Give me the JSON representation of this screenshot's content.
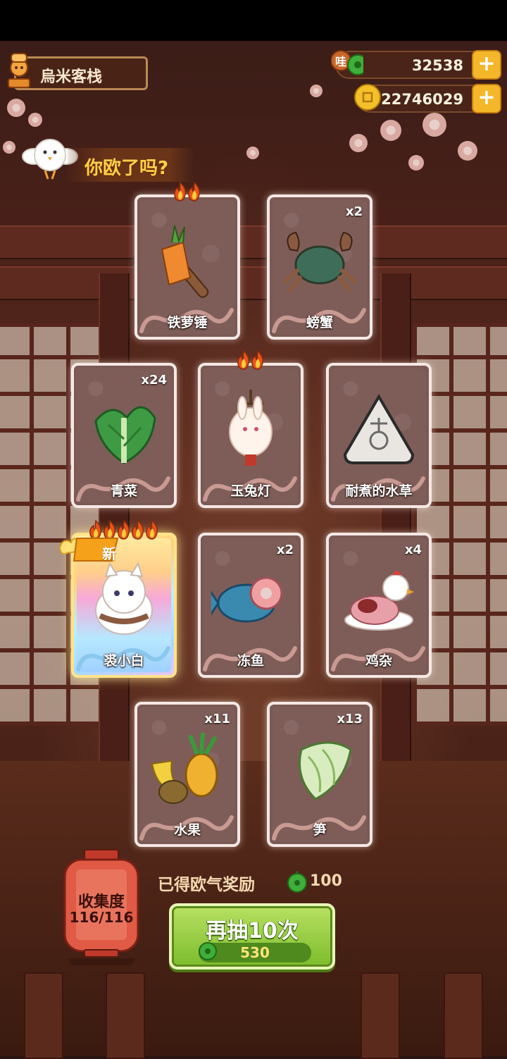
{
  "header": {
    "inn_name": "烏米客栈",
    "gems": "32538",
    "gem_badge": "哇",
    "coins": "22746029",
    "plus": "+"
  },
  "slogan": "你欧了吗?",
  "cards": [
    {
      "name": "铁萝锤",
      "count": "",
      "flames": 2,
      "art": "carrot-hammer",
      "rare": false,
      "new": false
    },
    {
      "name": "螃蟹",
      "count": "x2",
      "flames": 0,
      "art": "crab",
      "rare": false,
      "new": false
    },
    {
      "name": "青菜",
      "count": "x24",
      "flames": 0,
      "art": "bok-choy",
      "rare": false,
      "new": false
    },
    {
      "name": "玉兔灯",
      "count": "",
      "flames": 2,
      "art": "rabbit-lantern",
      "rare": false,
      "new": false
    },
    {
      "name": "耐煮的水草",
      "count": "",
      "flames": 0,
      "art": "seaweed-rice-ball",
      "rare": false,
      "new": false
    },
    {
      "name": "裘小白",
      "count": "",
      "flames": 5,
      "art": "white-cat",
      "rare": true,
      "new": true,
      "new_label": "新"
    },
    {
      "name": "冻鱼",
      "count": "x2",
      "flames": 0,
      "art": "frozen-fish",
      "rare": false,
      "new": false
    },
    {
      "name": "鸡杂",
      "count": "x4",
      "flames": 0,
      "art": "chicken-giblets",
      "rare": false,
      "new": false
    },
    {
      "name": "水果",
      "count": "x11",
      "flames": 0,
      "art": "fruits",
      "rare": false,
      "new": false
    },
    {
      "name": "笋",
      "count": "x13",
      "flames": 0,
      "art": "bamboo-shoot",
      "rare": false,
      "new": false
    }
  ],
  "collection": {
    "label": "收集度",
    "value": "116/116"
  },
  "reward": {
    "label": "已得欧气奖励",
    "amount": "100"
  },
  "draw_button": {
    "label": "再抽10次",
    "cost": "530"
  },
  "colors": {
    "card_frame": "#f5e8e4",
    "card_fill": "#7b5955",
    "gold": "#f4b72a",
    "green_button": "#8cc63a",
    "slogan": "#ffd24a"
  }
}
